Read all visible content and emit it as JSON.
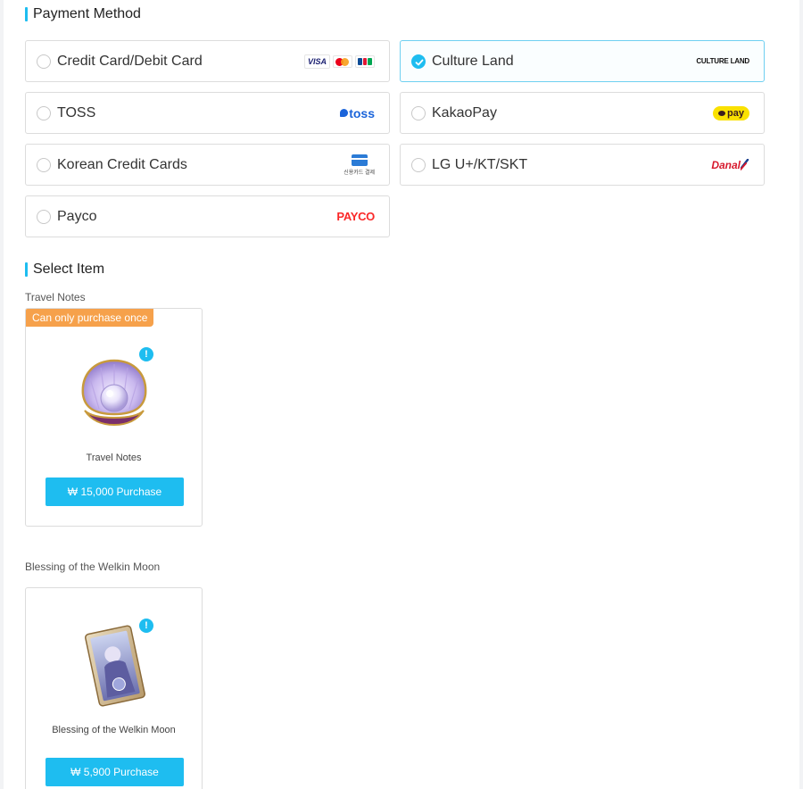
{
  "payment": {
    "title": "Payment Method",
    "options": [
      {
        "label": "Credit Card/Debit Card",
        "logo": "visa-mastercard-jcb",
        "selected": false
      },
      {
        "label": "Culture Land",
        "logo": "CULTURE LAND",
        "selected": true
      },
      {
        "label": "TOSS",
        "logo": "toss",
        "selected": false
      },
      {
        "label": "KakaoPay",
        "logo": "pay",
        "selected": false
      },
      {
        "label": "Korean Credit Cards",
        "logo": "신용카드 결제",
        "selected": false
      },
      {
        "label": "LG U+/KT/SKT",
        "logo": "Danal",
        "selected": false
      },
      {
        "label": "Payco",
        "logo": "PAYCO",
        "selected": false
      }
    ],
    "card_brands": [
      "VISA",
      "mastercard-icon",
      "jcb-icon"
    ]
  },
  "items": {
    "title": "Select Item",
    "groups": [
      {
        "group_title": "Travel Notes",
        "badge": "Can only purchase once",
        "name": "Travel Notes",
        "button": "₩ 15,000 Purchase",
        "image": "pearl-shell-icon"
      },
      {
        "group_title": "Blessing of the Welkin Moon",
        "name": "Blessing of the Welkin Moon",
        "button": "₩ 5,900 Purchase",
        "image": "welkin-card-icon"
      }
    ]
  },
  "colors": {
    "accent": "#1ebdf0",
    "badge": "#f6a14b",
    "border": "#dcdcdc"
  }
}
